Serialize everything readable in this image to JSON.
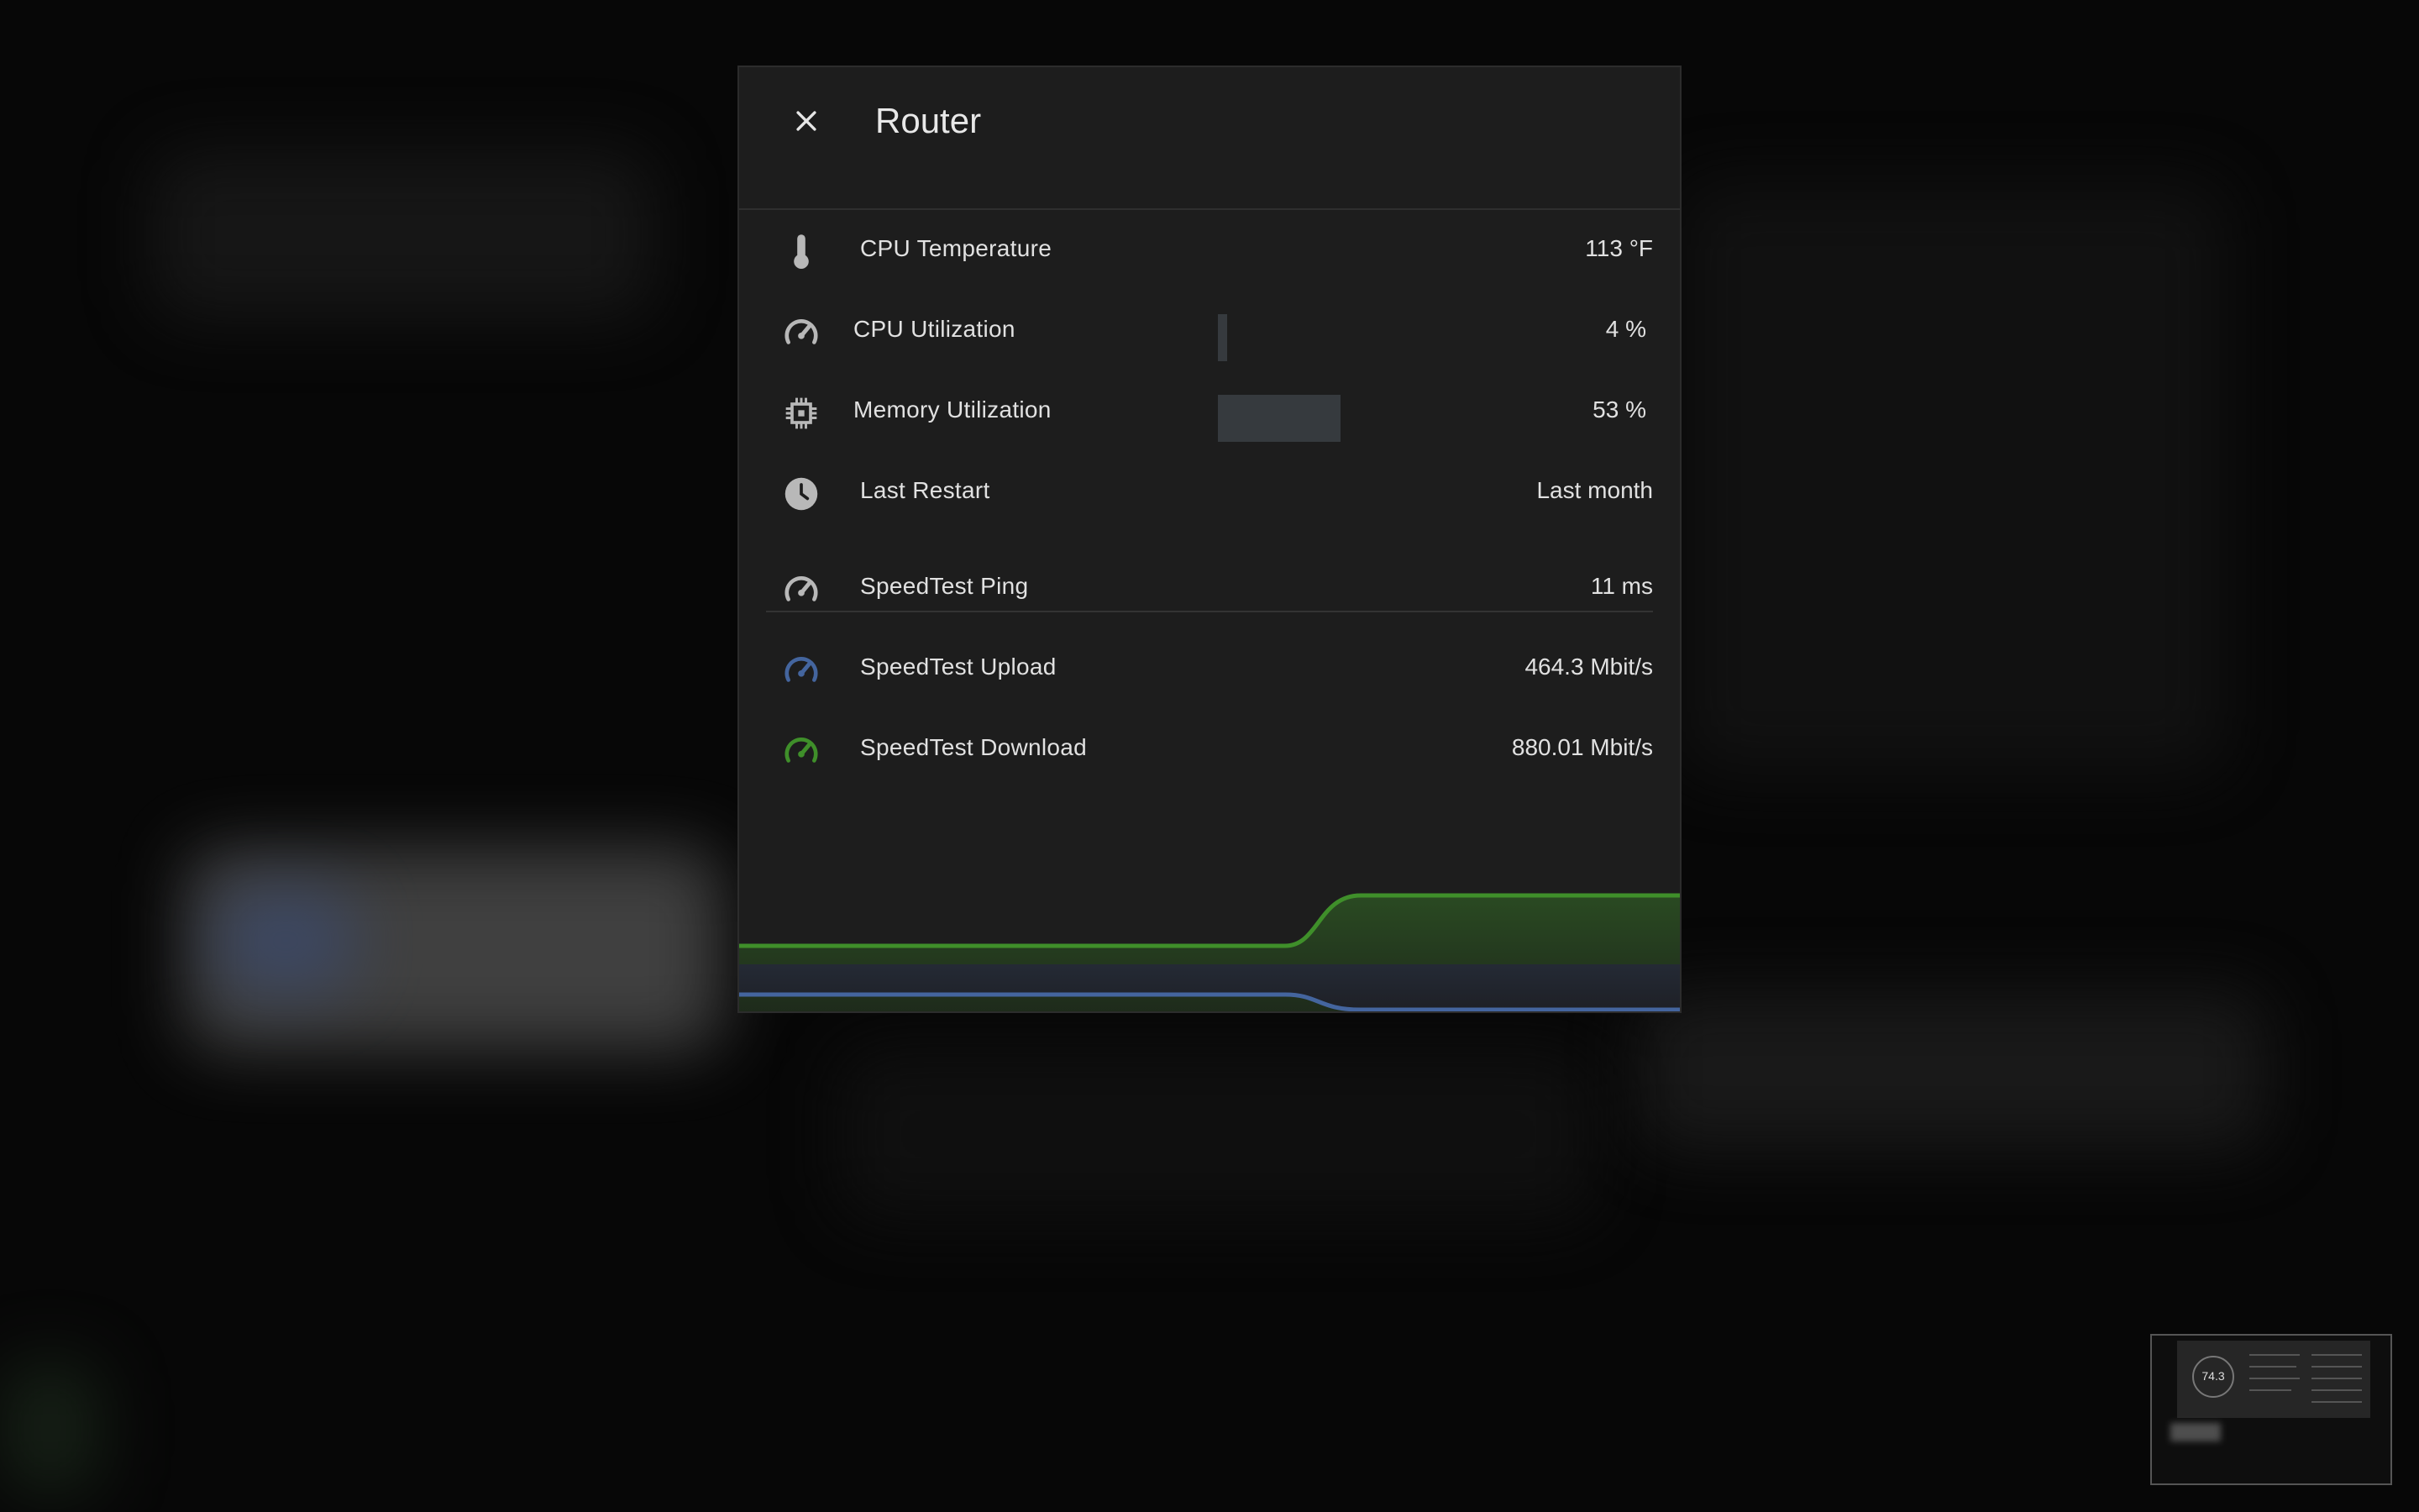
{
  "dialog": {
    "title": "Router",
    "close_icon": "close-icon"
  },
  "rows": [
    {
      "icon": "thermometer-icon",
      "label": "CPU Temperature",
      "value": "113 °F"
    },
    {
      "icon": "gauge-icon",
      "label": "CPU Utilization",
      "value": "4 %",
      "bar_percent": 4
    },
    {
      "icon": "chip-icon",
      "label": "Memory Utilization",
      "value": "53 %",
      "bar_percent": 53
    },
    {
      "icon": "clock-icon",
      "label": "Last Restart",
      "value": "Last month"
    },
    {
      "icon": "speedometer-icon",
      "label": "SpeedTest Ping",
      "value": "11 ms"
    },
    {
      "icon": "speedometer-upload-icon",
      "label": "SpeedTest Upload",
      "value": "464.3 Mbit/s"
    },
    {
      "icon": "speedometer-download-icon",
      "label": "SpeedTest Download",
      "value": "880.01 Mbit/s"
    }
  ],
  "colors": {
    "download": "#3f8f2a",
    "upload": "#44659e",
    "icon_default": "#b8b8b8"
  },
  "minimap": {
    "gauge_value": "74.3"
  }
}
